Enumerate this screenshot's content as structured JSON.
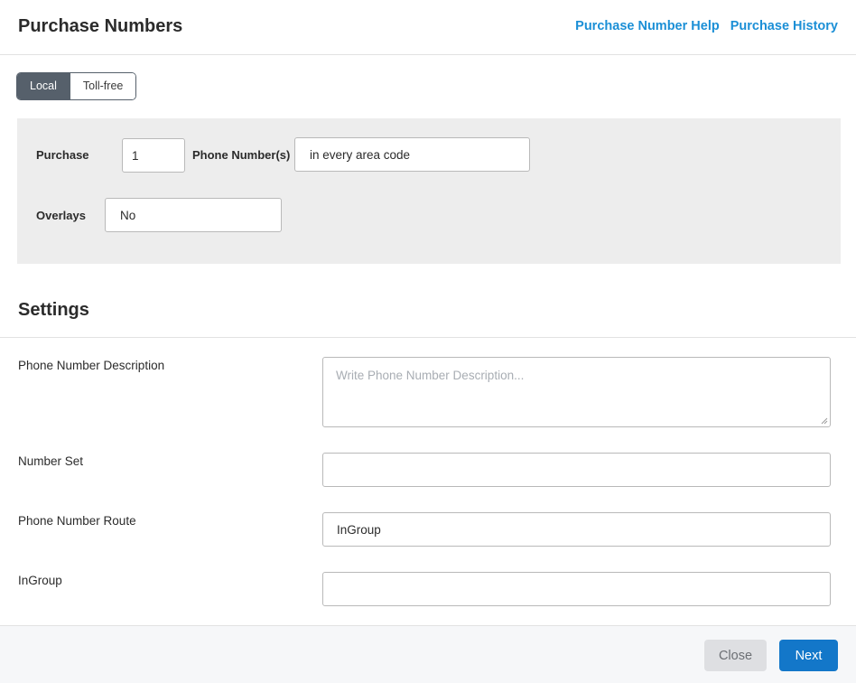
{
  "header": {
    "title": "Purchase Numbers",
    "links": [
      "Purchase Number Help",
      "Purchase History"
    ]
  },
  "tabs": {
    "active": "Local",
    "inactive": "Toll-free"
  },
  "purchase_panel": {
    "purchase_label": "Purchase",
    "quantity_value": "1",
    "phone_numbers_label": "Phone Number(s)",
    "area_code_value": "in every area code",
    "overlays_label": "Overlays",
    "overlays_value": "No"
  },
  "settings": {
    "title": "Settings",
    "description_label": "Phone Number Description",
    "description_placeholder": "Write Phone Number Description...",
    "number_set_label": "Number Set",
    "number_set_value": "",
    "route_label": "Phone Number Route",
    "route_value": "InGroup",
    "ingroup_label": "InGroup",
    "ingroup_value": ""
  },
  "footer": {
    "close_label": "Close",
    "next_label": "Next"
  }
}
